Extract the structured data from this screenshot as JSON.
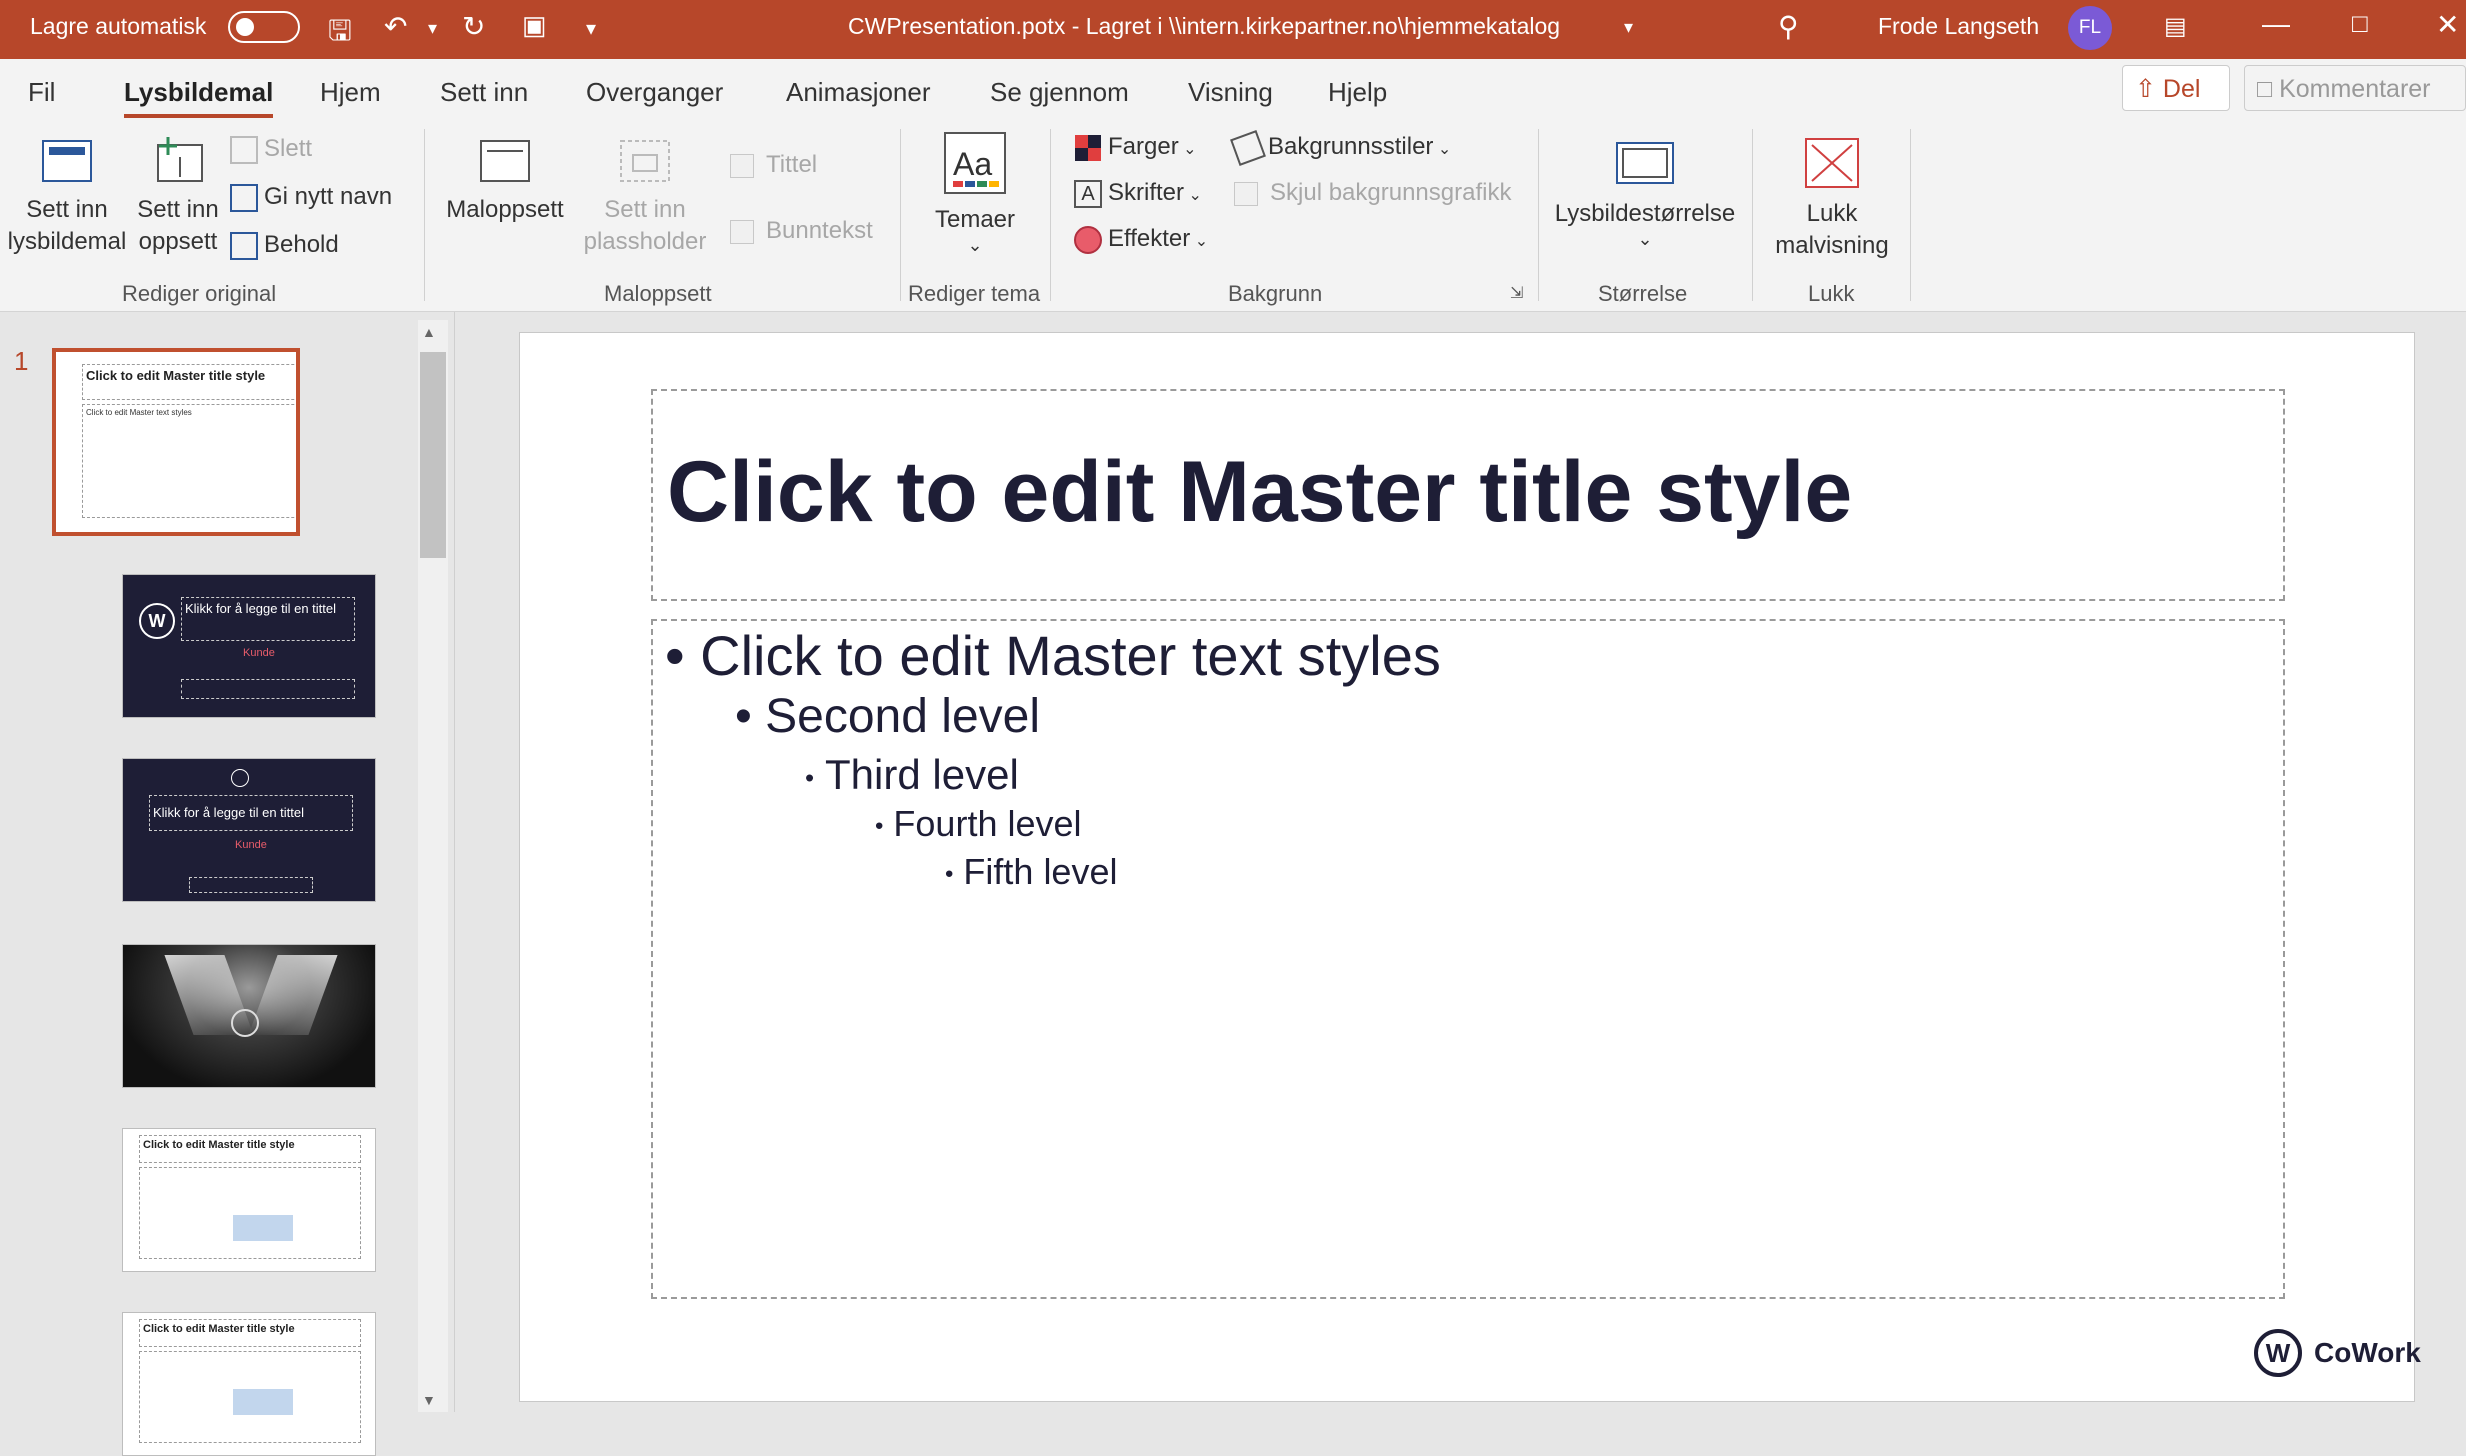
{
  "titlebar": {
    "autosave_label": "Lagre automatisk",
    "document_title": "CWPresentation.potx  -  Lagret i \\\\intern.kirkepartner.no\\hjemmekatalog",
    "user_name": "Frode Langseth",
    "user_initials": "FL",
    "accent_color": "#b7472a"
  },
  "tabs": [
    "Fil",
    "Lysbildemal",
    "Hjem",
    "Sett inn",
    "Overganger",
    "Animasjoner",
    "Se gjennom",
    "Visning",
    "Hjelp"
  ],
  "share_label": "Del",
  "comments_label": "Kommentarer",
  "ribbon": {
    "insert_master_1": "Sett inn",
    "insert_master_2": "lysbildemal",
    "insert_layout_1": "Sett inn",
    "insert_layout_2": "oppsett",
    "delete": "Slett",
    "rename": "Gi nytt navn",
    "preserve": "Behold",
    "group_edit_master": "Rediger original",
    "master_layout": "Maloppsett",
    "insert_placeholder_1": "Sett inn",
    "insert_placeholder_2": "plassholder",
    "title_chk": "Tittel",
    "footer_chk": "Bunntekst",
    "group_master_layout": "Maloppsett",
    "themes": "Temaer",
    "group_edit_theme": "Rediger tema",
    "colors": "Farger",
    "fonts": "Skrifter",
    "effects": "Effekter",
    "bg_styles": "Bakgrunnsstiler",
    "hide_bg": "Skjul bakgrunnsgrafikk",
    "group_background": "Bakgrunn",
    "slide_size": "Lysbildestørrelse",
    "group_size": "Størrelse",
    "close_1": "Lukk",
    "close_2": "malvisning",
    "group_close": "Lukk"
  },
  "thumbnails": {
    "number": "1",
    "t1_title": "Click to edit Master title style",
    "t1_body": "Click to edit Master text styles",
    "t2_title": "Klikk for å legge til en tittel",
    "t2_sub": "Kunde",
    "t3_title": "Klikk for å legge til en tittel",
    "t3_sub": "Kunde",
    "t5_title": "Click to edit Master title style",
    "t6_title": "Click to edit Master title style"
  },
  "slide": {
    "title": "Click to edit Master title style",
    "levels": [
      "Click to edit Master text styles",
      "Second level",
      "Third level",
      "Fourth level",
      "Fifth level"
    ],
    "logo_text": "CoWork",
    "logo_letter": "W"
  }
}
